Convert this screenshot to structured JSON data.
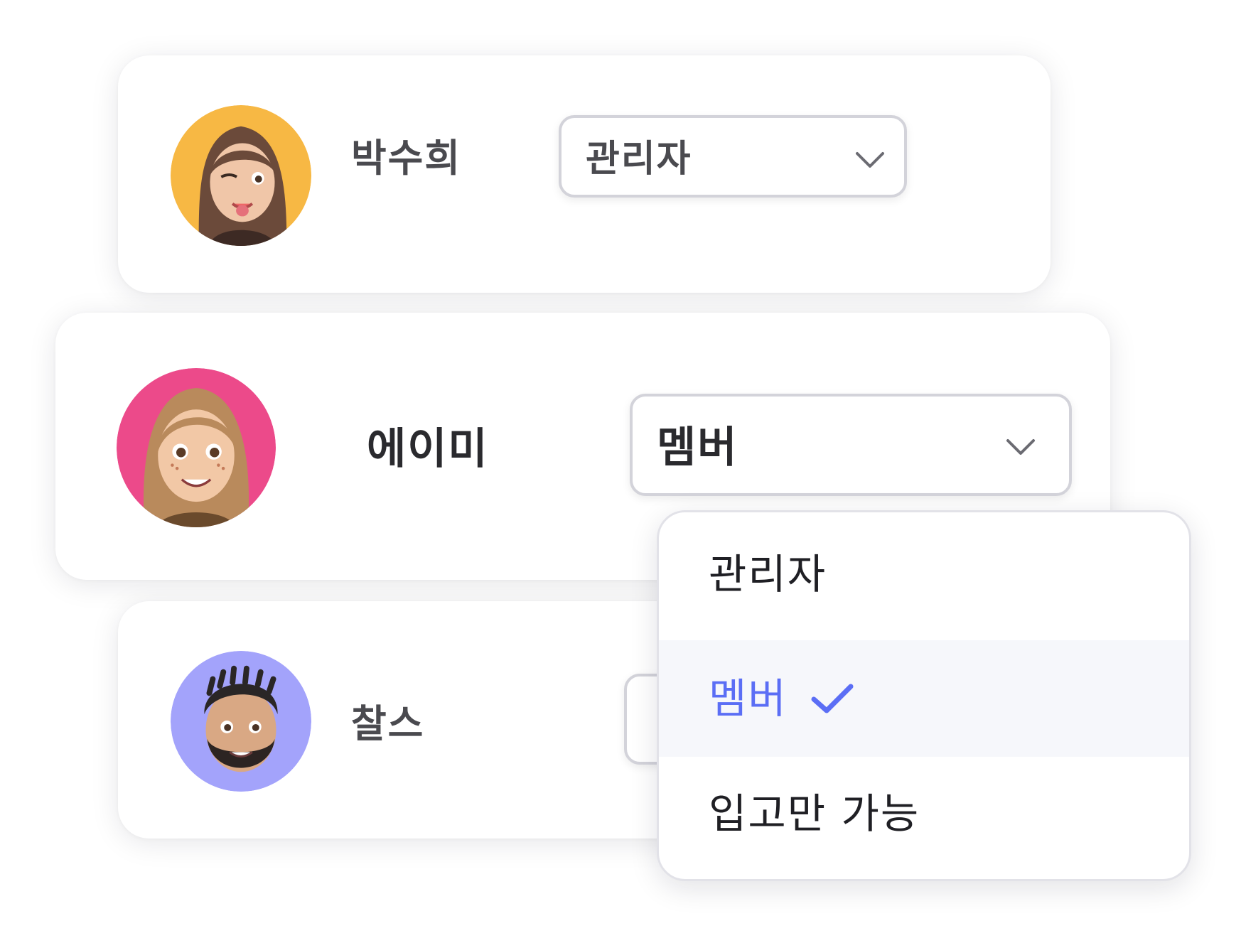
{
  "members": [
    {
      "name": "박수희",
      "role": "관리자",
      "avatar_color": "#f7b844"
    },
    {
      "name": "에이미",
      "role": "멤버",
      "avatar_color": "#ec4a8a"
    },
    {
      "name": "찰스",
      "role": "",
      "avatar_color": "#a3a3fb"
    }
  ],
  "dropdown": {
    "options": [
      {
        "label": "관리자",
        "selected": false
      },
      {
        "label": "멤버",
        "selected": true
      },
      {
        "label": "입고만 가능",
        "selected": false
      }
    ],
    "selected_color": "#5b6ef5",
    "check_icon": "check-icon"
  },
  "colors": {
    "text": "#4a4a4f",
    "border": "#d3d3da",
    "chevron": "#6b6b72"
  }
}
